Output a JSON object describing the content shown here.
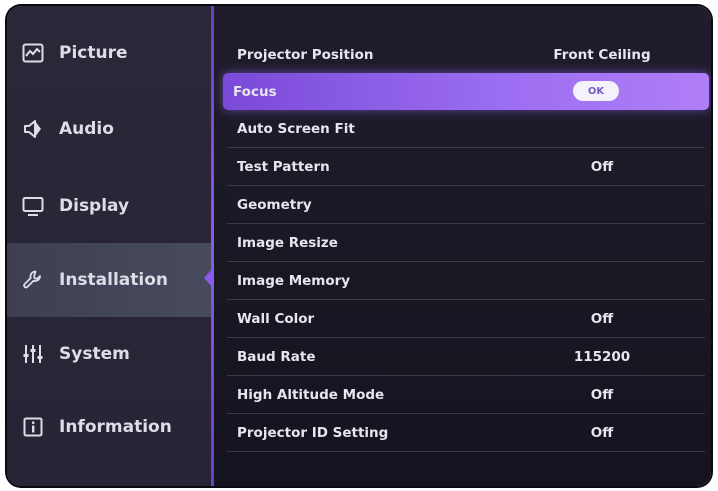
{
  "sidebar": {
    "items": [
      {
        "label": "Picture",
        "icon": "picture-icon"
      },
      {
        "label": "Audio",
        "icon": "speaker-icon"
      },
      {
        "label": "Display",
        "icon": "monitor-icon"
      },
      {
        "label": "Installation",
        "icon": "wrench-icon",
        "active": true
      },
      {
        "label": "System",
        "icon": "sliders-icon"
      },
      {
        "label": "Information",
        "icon": "info-icon"
      }
    ]
  },
  "menu": {
    "rows": [
      {
        "label": "Projector Position",
        "value": "Front Ceiling"
      },
      {
        "label": "Focus",
        "button": "OK",
        "highlighted": true
      },
      {
        "label": "Auto Screen Fit",
        "value": ""
      },
      {
        "label": "Test Pattern",
        "value": "Off"
      },
      {
        "label": "Geometry",
        "value": ""
      },
      {
        "label": "Image Resize",
        "value": ""
      },
      {
        "label": "Image Memory",
        "value": ""
      },
      {
        "label": "Wall Color",
        "value": "Off"
      },
      {
        "label": "Baud Rate",
        "value": "115200"
      },
      {
        "label": "High Altitude Mode",
        "value": "Off"
      },
      {
        "label": "Projector ID Setting",
        "value": "Off"
      }
    ]
  },
  "colors": {
    "highlight": "#9a6cf0",
    "divider": "#8a5ae8",
    "text": "#e6e6ee"
  }
}
